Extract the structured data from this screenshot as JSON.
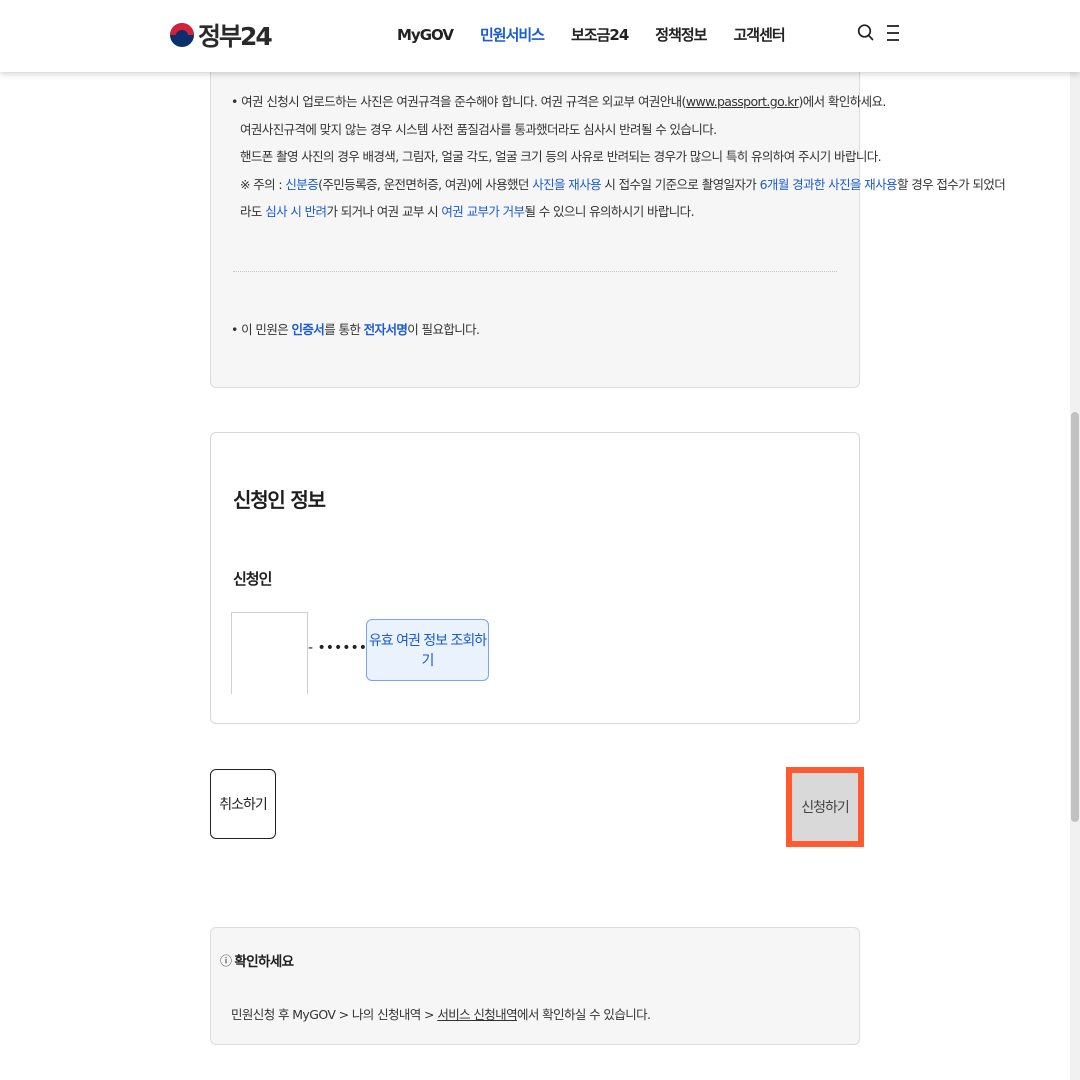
{
  "header": {
    "logo_text": "정부24",
    "nav": [
      "MyGOV",
      "민원서비스",
      "보조금24",
      "정책정보",
      "고객센터"
    ],
    "active_nav_index": 1
  },
  "notice": {
    "line1_pre": "• 여권 신청시 업로드하는 사진은 여권규격을 준수해야 합니다. 여권 규격은 외교부 여권안내(",
    "line1_link": "www.passport.go.kr",
    "line1_post": ")에서 확인하세요.",
    "line2": "여권사진규격에 맞지 않는 경우 시스템 사전 품질검사를 통과했더라도 심사시 반려될 수 있습니다.",
    "line3": "핸드폰 촬영 사진의 경우 배경색, 그림자, 얼굴 각도, 얼굴 크기 등의 사유로 반려되는 경우가 많으니 특히 유의하여 주시기 바랍니다.",
    "line4_a": "※ 주의 : ",
    "line4_b": "신분증",
    "line4_c": "(주민등록증, 운전면허증, 여권)에 사용했던 ",
    "line4_d": "사진을 재사용",
    "line4_e": " 시 접수일 기준으로 촬영일자가 ",
    "line4_f": "6개월 경과한 사진을 재사용",
    "line4_g": "할 경우 접수가 되었더",
    "line5_a": "라도 ",
    "line5_b": "심사 시 반려",
    "line5_c": "가 되거나 여권 교부 시 ",
    "line5_d": "여권 교부가 거부",
    "line5_e": "될 수 있으니 유의하시기 바랍니다.",
    "cert_a": "• 이 민원은 ",
    "cert_b": "인증서",
    "cert_c": "를 통한 ",
    "cert_d": "전자서명",
    "cert_e": "이 필요합니다."
  },
  "applicant": {
    "section_title": "신청인 정보",
    "field_label": "신청인",
    "id_masked": "- •••••••)",
    "lookup_button": "유효 여권 정보 조회하기"
  },
  "actions": {
    "cancel": "취소하기",
    "submit": "신청하기"
  },
  "confirm": {
    "icon": "ⓘ",
    "title": "확인하세요",
    "text_pre": "민원신청 후 MyGOV > 나의 신청내역 > ",
    "text_link": "서비스 신청내역",
    "text_post": "에서 확인하실 수 있습니다."
  },
  "colors": {
    "accent_blue": "#1b5bd3",
    "highlight_orange": "#ff5a30"
  }
}
